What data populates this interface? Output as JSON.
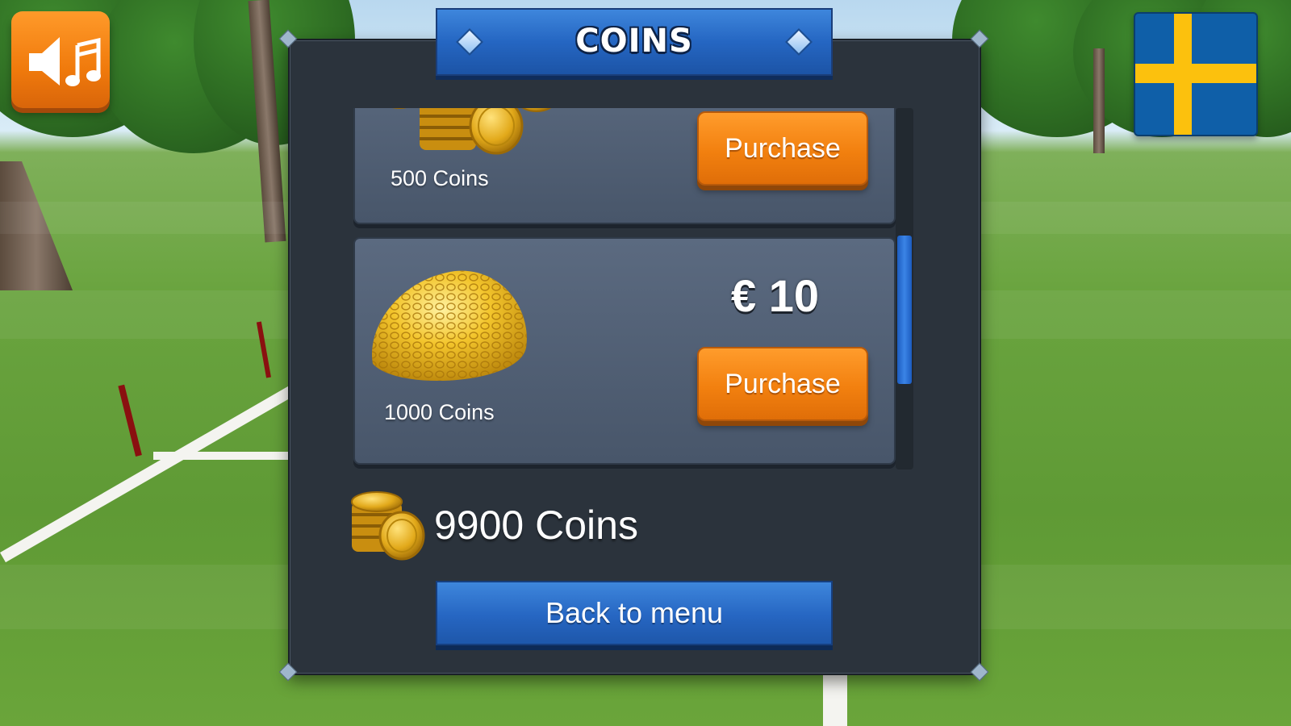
{
  "header": {
    "title": "COINS"
  },
  "top_left": {
    "icon": "sound-music-icon"
  },
  "top_right": {
    "icon": "sweden-flag-icon",
    "colors": {
      "blue": "#0f5fa8",
      "yellow": "#fcc10d"
    }
  },
  "shop": {
    "items": [
      {
        "label": "500 Coins",
        "price": "",
        "button": "Purchase",
        "icon": "coin-stack-icon"
      },
      {
        "label": "1000 Coins",
        "price": "€ 10",
        "button": "Purchase",
        "icon": "coin-pile-icon"
      }
    ],
    "scroll_position": 0.6
  },
  "balance": {
    "text": "9900 Coins",
    "icon": "coin-stack-icon"
  },
  "footer": {
    "back_label": "Back to menu"
  },
  "colors": {
    "accent_blue": "#2566c2",
    "button_orange": "#f2800f",
    "panel": "#2b333c",
    "card": "#4f5d72"
  }
}
